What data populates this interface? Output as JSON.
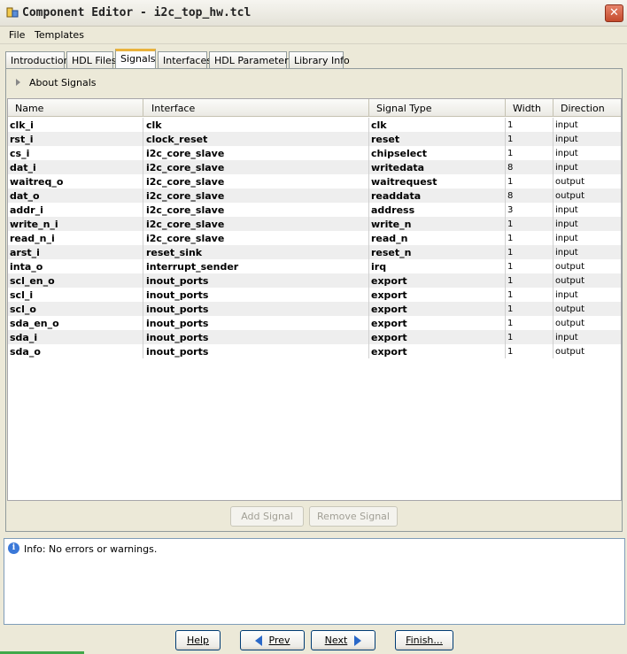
{
  "window": {
    "title": "Component Editor - i2c_top_hw.tcl",
    "close_label": "✕"
  },
  "menu": {
    "file": "File",
    "templates": "Templates"
  },
  "tabs": [
    {
      "label": "Introduction"
    },
    {
      "label": "HDL Files"
    },
    {
      "label": "Signals",
      "active": true
    },
    {
      "label": "Interfaces"
    },
    {
      "label": "HDL Parameters"
    },
    {
      "label": "Library Info"
    }
  ],
  "about": {
    "label": "About Signals"
  },
  "table": {
    "headers": [
      "Name",
      "Interface",
      "Signal Type",
      "Width",
      "Direction"
    ],
    "rows": [
      [
        "clk_i",
        "clk",
        "clk",
        "1",
        "input"
      ],
      [
        "rst_i",
        "clock_reset",
        "reset",
        "1",
        "input"
      ],
      [
        "cs_i",
        "i2c_core_slave",
        "chipselect",
        "1",
        "input"
      ],
      [
        "dat_i",
        "i2c_core_slave",
        "writedata",
        "8",
        "input"
      ],
      [
        "waitreq_o",
        "i2c_core_slave",
        "waitrequest",
        "1",
        "output"
      ],
      [
        "dat_o",
        "i2c_core_slave",
        "readdata",
        "8",
        "output"
      ],
      [
        "addr_i",
        "i2c_core_slave",
        "address",
        "3",
        "input"
      ],
      [
        "write_n_i",
        "i2c_core_slave",
        "write_n",
        "1",
        "input"
      ],
      [
        "read_n_i",
        "i2c_core_slave",
        "read_n",
        "1",
        "input"
      ],
      [
        "arst_i",
        "reset_sink",
        "reset_n",
        "1",
        "input"
      ],
      [
        "inta_o",
        "interrupt_sender",
        "irq",
        "1",
        "output"
      ],
      [
        "scl_en_o",
        "inout_ports",
        "export",
        "1",
        "output"
      ],
      [
        "scl_i",
        "inout_ports",
        "export",
        "1",
        "input"
      ],
      [
        "scl_o",
        "inout_ports",
        "export",
        "1",
        "output"
      ],
      [
        "sda_en_o",
        "inout_ports",
        "export",
        "1",
        "output"
      ],
      [
        "sda_i",
        "inout_ports",
        "export",
        "1",
        "input"
      ],
      [
        "sda_o",
        "inout_ports",
        "export",
        "1",
        "output"
      ]
    ]
  },
  "buttons": {
    "add_signal": "Add Signal",
    "remove_signal": "Remove Signal",
    "help": "Help",
    "prev": "Prev",
    "next": "Next",
    "finish": "Finish..."
  },
  "info": {
    "icon_glyph": "i",
    "message": "Info: No errors or warnings."
  },
  "icons": {
    "app": "component-editor-icon",
    "close": "close-icon",
    "expand": "triangle-right-icon",
    "info": "info-icon",
    "prev": "arrow-left-icon",
    "next": "arrow-right-icon"
  },
  "colors": {
    "active_tab_accent": "#e9b23d",
    "close_button": "#c44a2c",
    "nav_arrow": "#2a68c8",
    "alt_row": "#eeeeee"
  }
}
